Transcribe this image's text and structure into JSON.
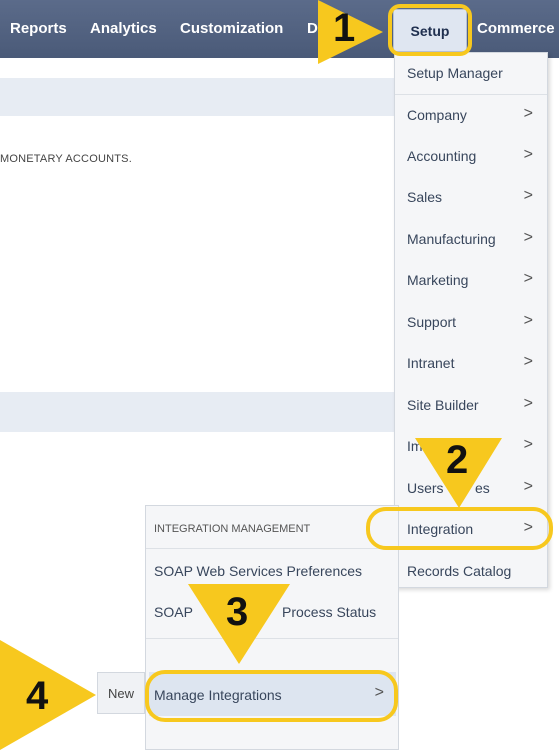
{
  "nav": {
    "items": [
      "Reports",
      "Analytics",
      "Customization",
      "Doc",
      "Commerce"
    ],
    "active": "Setup"
  },
  "page": {
    "text": "MONETARY ACCOUNTS."
  },
  "setup_menu": {
    "items": [
      {
        "label": "Setup Manager",
        "has_submenu": false
      },
      {
        "label": "Company",
        "has_submenu": true
      },
      {
        "label": "Accounting",
        "has_submenu": true
      },
      {
        "label": "Sales",
        "has_submenu": true
      },
      {
        "label": "Manufacturing",
        "has_submenu": true
      },
      {
        "label": "Marketing",
        "has_submenu": true
      },
      {
        "label": "Support",
        "has_submenu": true
      },
      {
        "label": "Intranet",
        "has_submenu": true
      },
      {
        "label": "Site Builder",
        "has_submenu": true
      },
      {
        "label": "Im",
        "has_submenu": true
      },
      {
        "label": "Users",
        "label_tail": "es",
        "has_submenu": true
      },
      {
        "label": "Integration",
        "has_submenu": true
      },
      {
        "label": "Records Catalog",
        "has_submenu": false
      }
    ],
    "chevron": ">"
  },
  "integration_menu": {
    "header": "INTEGRATION MANAGEMENT",
    "items": [
      {
        "label": "SOAP Web Services Preferences"
      },
      {
        "label": "SOAP",
        "label_tail": "Process Status"
      },
      {
        "label": "Manage Integrations"
      }
    ]
  },
  "new_button": "New",
  "annotations": {
    "steps": [
      "1",
      "2",
      "3",
      "4"
    ],
    "color": "#f7c81e"
  }
}
